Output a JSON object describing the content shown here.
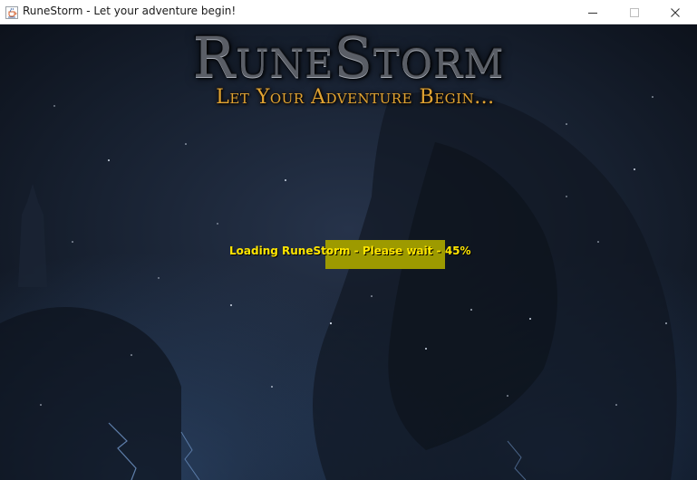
{
  "window": {
    "title": "RuneStorm - Let your adventure begin!",
    "icon": "java-cup-icon"
  },
  "titlebar_buttons": {
    "minimize_icon": "minimize-icon",
    "maximize_icon": "maximize-icon",
    "close_icon": "close-icon"
  },
  "banner": {
    "logo": "RuneStorm",
    "tagline": "Let Your Adventure Begin..."
  },
  "loading": {
    "message": "Loading RuneStorm - Please wait - 45%",
    "progress_fraction": 0.45,
    "fill_color": "#9d9a00",
    "text_color": "#ffe600"
  },
  "theme": {
    "background": "#0b1019",
    "logo_color": "#5a5e66",
    "tagline_color": "#e2a432"
  }
}
